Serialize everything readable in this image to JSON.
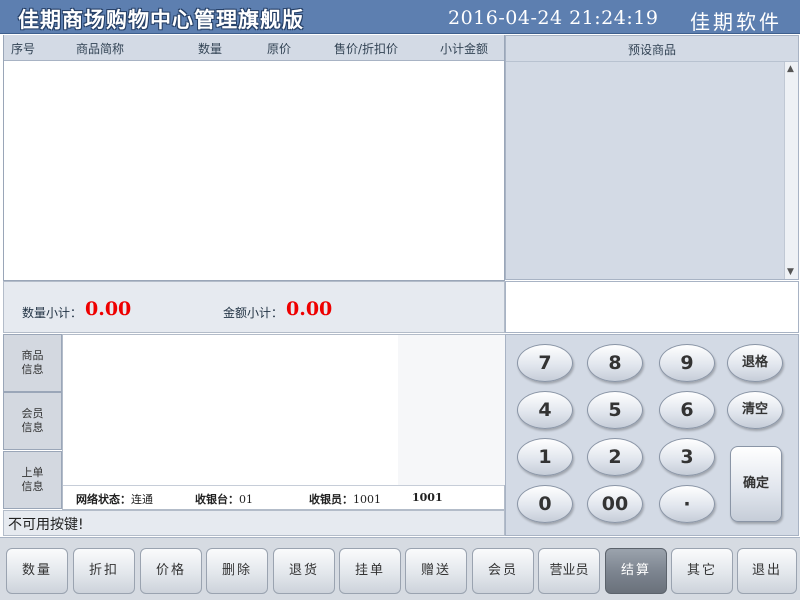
{
  "header": {
    "title": "佳期商场购物中心管理旗舰版",
    "datetime": "2016-04-24  21:24:19",
    "brand": "佳期软件"
  },
  "sales_table": {
    "columns": [
      "序号",
      "商品简称",
      "数量",
      "原价",
      "售价/折扣价",
      "小计金额"
    ],
    "rows": []
  },
  "subtotal": {
    "qty_label": "数量小计：",
    "qty_value": "0.00",
    "amount_label": "金额小计：",
    "amount_value": "0.00"
  },
  "preset": {
    "title": "预设商品",
    "items": []
  },
  "side_tabs": [
    {
      "line1": "商品",
      "line2": "信息"
    },
    {
      "line1": "会员",
      "line2": "信息"
    },
    {
      "line1": "上单",
      "line2": "信息"
    }
  ],
  "status": {
    "network_label": "网络状态：",
    "network_value": "连通",
    "register_label": "收银台：",
    "register_value": "01",
    "cashier_label": "收银员：",
    "cashier_value": "1001",
    "cashier_name": "1001"
  },
  "message": "不可用按键!",
  "keypad": {
    "keys": [
      "7",
      "8",
      "9",
      "退格",
      "4",
      "5",
      "6",
      "清空",
      "1",
      "2",
      "3",
      "0",
      "00",
      "·"
    ],
    "confirm": "确定"
  },
  "function_buttons": [
    "数量",
    "折扣",
    "价格",
    "删除",
    "退货",
    "挂单",
    "赠送",
    "会员",
    "营业员",
    "结算",
    "其它",
    "退出"
  ],
  "active_function": "结算",
  "colors": {
    "title_bar": "#5d7fb0",
    "panel": "#d3dae5",
    "subtotal_value": "#ee0000",
    "active_button": "#7b838e"
  }
}
